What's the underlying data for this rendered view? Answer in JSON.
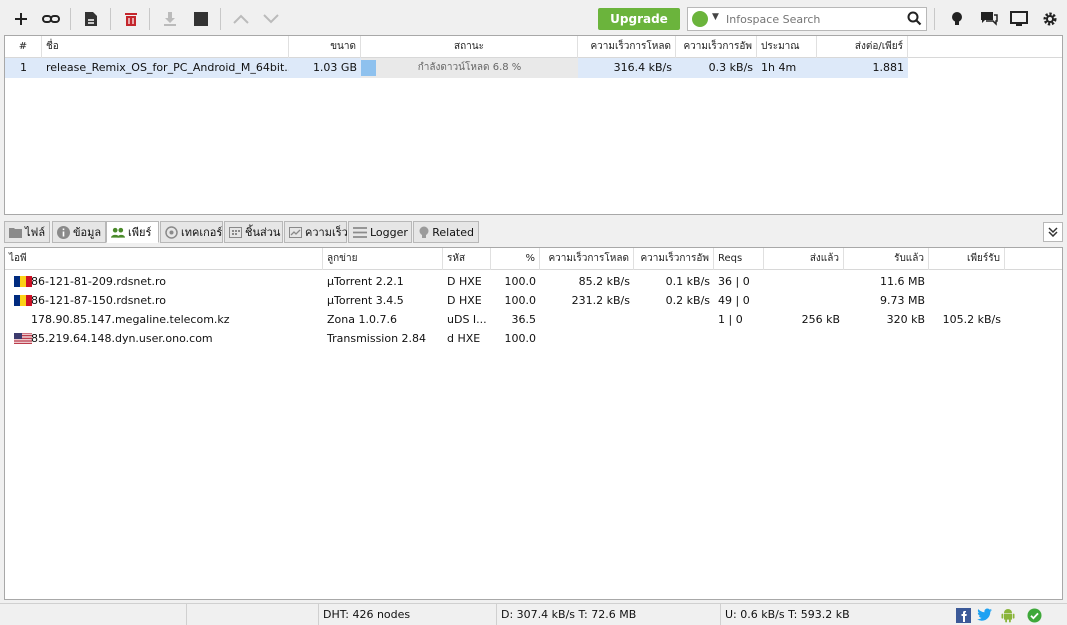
{
  "toolbar": {
    "upgrade_label": "Upgrade",
    "search_placeholder": "Infospace Search"
  },
  "torrents": {
    "columns": [
      "#",
      "ชื่อ",
      "ขนาด",
      "สถานะ",
      "ความเร็วการโหลด",
      "ความเร็วการอัพ",
      "ประมาณ",
      "ส่งต่อ/เพียร์"
    ],
    "rows": [
      {
        "index": "1",
        "name": "release_Remix_OS_for_PC_Android_M_64bit...",
        "size": "1.03 GB",
        "status": "กำลังดาวน์โหลด 6.8 %",
        "progress": 0.068,
        "down_speed": "316.4 kB/s",
        "up_speed": "0.3 kB/s",
        "eta": "1h 4m",
        "ratio": "1.881"
      }
    ]
  },
  "tabs": [
    "ไฟล์",
    "ข้อมูล",
    "เพียร์",
    "เทคเกอร์",
    "ชิ้นส่วน",
    "ความเร็ว",
    "Logger",
    "Related"
  ],
  "peers": {
    "columns": [
      "ไอพี",
      "ลูกข่าย",
      "รหัส",
      "%",
      "ความเร็วการโหลด",
      "ความเร็วการอัพ",
      "Reqs",
      "ส่งแล้ว",
      "รับแล้ว",
      "เพียร์รับ"
    ],
    "rows": [
      {
        "flag": "ro",
        "ip": "86-121-81-209.rdsnet.ro",
        "client": "µTorrent 2.2.1",
        "flags": "D HXE",
        "percent": "100.0",
        "down": "85.2 kB/s",
        "up": "0.1 kB/s",
        "reqs": "36 | 0",
        "uploaded": "",
        "downloaded": "11.6 MB",
        "peer_dl": ""
      },
      {
        "flag": "ro",
        "ip": "86-121-87-150.rdsnet.ro",
        "client": "µTorrent 3.4.5",
        "flags": "D HXE",
        "percent": "100.0",
        "down": "231.2 kB/s",
        "up": "0.2 kB/s",
        "reqs": "49 | 0",
        "uploaded": "",
        "downloaded": "9.73 MB",
        "peer_dl": ""
      },
      {
        "flag": "",
        "ip": "178.90.85.147.megaline.telecom.kz",
        "client": "Zona 1.0.7.6",
        "flags": "uDS I...",
        "percent": "36.5",
        "down": "",
        "up": "",
        "reqs": "1 | 0",
        "uploaded": "256 kB",
        "downloaded": "320 kB",
        "peer_dl": "105.2 kB/s"
      },
      {
        "flag": "us",
        "ip": "85.219.64.148.dyn.user.ono.com",
        "client": "Transmission 2.84",
        "flags": "d HXE",
        "percent": "100.0",
        "down": "",
        "up": "",
        "reqs": "",
        "uploaded": "",
        "downloaded": "",
        "peer_dl": ""
      }
    ]
  },
  "statusbar": {
    "dht": "DHT: 426 nodes",
    "download": "D: 307.4 kB/s T: 72.6 MB",
    "upload": "U: 0.6 kB/s T: 593.2 kB"
  },
  "colors": {
    "accent_green": "#6bb43c",
    "selection": "#dde9f9",
    "progress": "#8ec1ee"
  }
}
